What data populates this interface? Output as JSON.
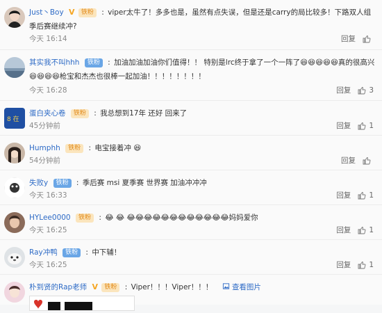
{
  "comments": [
    {
      "user": "Just丶Boy",
      "badges": [
        "V",
        "铁粉"
      ],
      "text": "viper太牛了！多多也是，虽然有点失误，但是还是carry的局比较多！下路双人组季后赛继续冲?",
      "time": "今天 16:14",
      "reply_label": "回复",
      "like_count": ""
    },
    {
      "user": "其实我不叫hhh",
      "badges": [
        "铁粉"
      ],
      "text": "加油加油加油你们值得！！ 特别是lrc终于拿了一个一阵了😆😆😆😆😆真的很高兴😆😆😆😆枪宝和杰杰也很棒一起加油！！！！！！！！",
      "time": "今天 16:28",
      "reply_label": "回复",
      "like_count": "3"
    },
    {
      "user": "蛋白夹心卷",
      "badges": [
        "铁粉"
      ],
      "text": "我总想到17年 还好 回来了",
      "time": "45分钟前",
      "reply_label": "回复",
      "like_count": "1"
    },
    {
      "user": "Humphh",
      "badges": [
        "铁粉"
      ],
      "text": "电宝接着冲",
      "time": "54分钟前",
      "reply_label": "回复",
      "like_count": ""
    },
    {
      "user": "失败y",
      "badges": [
        "铁粉"
      ],
      "text": "季后赛 msi 夏季赛 世界赛 加油冲冲冲",
      "time": "今天 16:33",
      "reply_label": "回复",
      "like_count": "1"
    },
    {
      "user": "HYLee0000",
      "badges": [
        "铁粉"
      ],
      "text": "😂 😂 😂😂😂😂😂😂😂😂😂😂😂😂妈妈爱你",
      "time": "今天 16:25",
      "reply_label": "回复",
      "like_count": "1"
    },
    {
      "user": "Ray冲鸭",
      "badges": [
        "铁粉"
      ],
      "text": "中下辅！",
      "time": "今天 16:25",
      "reply_label": "回复",
      "like_count": "1"
    },
    {
      "user": "朴到贤的Rap老师",
      "badges": [
        "V",
        "铁粉"
      ],
      "text": "Viper！！！Viper！！！",
      "view_pic": "查看图片",
      "time": "",
      "reply_label": "",
      "like_count": ""
    }
  ],
  "colors": {
    "link": "#2e6bc6",
    "fan_badge": "#fbe5bd",
    "fan_badge_text": "#e28a19",
    "vip": "#f5a623"
  }
}
